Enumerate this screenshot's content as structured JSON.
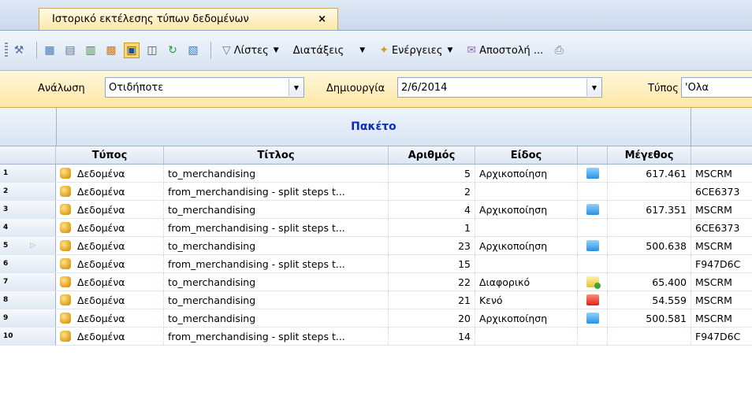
{
  "tab": {
    "title": "Ιστορικό εκτέλεσης τύπων δεδομένων",
    "close": "×"
  },
  "toolbar": {
    "lists_label": "Λίστες",
    "sorts_label": "Διατάξεις",
    "actions_label": "Ενέργειες",
    "send_label": "Αποστολή ..."
  },
  "filters": {
    "analysis_label": "Ανάλωση",
    "analysis_value": "Οτιδήποτε",
    "created_label": "Δημιουργία",
    "created_value": "2/6/2014",
    "type_label": "Τύπος",
    "type_value": "'Ολα"
  },
  "grid": {
    "group_header": "Πακέτο",
    "columns": {
      "type": "Τύπος",
      "title": "Τίτλος",
      "number": "Αριθμός",
      "kind": "Είδος",
      "size": "Μέγεθος"
    },
    "rows": [
      {
        "n": "1",
        "type": "Δεδομένα",
        "title": "to_merchandising",
        "number": "5",
        "kind": "Αρχικοποίηση",
        "kind_icon": "blue",
        "size": "617.461",
        "extra": "MSCRM"
      },
      {
        "n": "2",
        "type": "Δεδομένα",
        "title": "from_merchandising - split steps t...",
        "number": "2",
        "kind": "",
        "kind_icon": "",
        "size": "",
        "extra": "6CE6373"
      },
      {
        "n": "3",
        "type": "Δεδομένα",
        "title": "to_merchandising",
        "number": "4",
        "kind": "Αρχικοποίηση",
        "kind_icon": "blue",
        "size": "617.351",
        "extra": "MSCRM"
      },
      {
        "n": "4",
        "type": "Δεδομένα",
        "title": "from_merchandising - split steps t...",
        "number": "1",
        "kind": "",
        "kind_icon": "",
        "size": "",
        "extra": "6CE6373"
      },
      {
        "n": "5",
        "type": "Δεδομένα",
        "title": "to_merchandising",
        "number": "23",
        "kind": "Αρχικοποίηση",
        "kind_icon": "blue",
        "size": "500.638",
        "extra": "MSCRM"
      },
      {
        "n": "6",
        "type": "Δεδομένα",
        "title": "from_merchandising - split steps t...",
        "number": "15",
        "kind": "",
        "kind_icon": "",
        "size": "",
        "extra": "F947D6C"
      },
      {
        "n": "7",
        "type": "Δεδομένα",
        "title": "to_merchandising",
        "number": "22",
        "kind": "Διαφορικό",
        "kind_icon": "yellow",
        "size": "65.400",
        "extra": "MSCRM"
      },
      {
        "n": "8",
        "type": "Δεδομένα",
        "title": "to_merchandising",
        "number": "21",
        "kind": "Κενό",
        "kind_icon": "red",
        "size": "54.559",
        "extra": "MSCRM"
      },
      {
        "n": "9",
        "type": "Δεδομένα",
        "title": "to_merchandising",
        "number": "20",
        "kind": "Αρχικοποίηση",
        "kind_icon": "blue",
        "size": "500.581",
        "extra": "MSCRM"
      },
      {
        "n": "10",
        "type": "Δεδομένα",
        "title": "from_merchandising - split steps t...",
        "number": "14",
        "kind": "",
        "kind_icon": "",
        "size": "",
        "extra": "F947D6C"
      }
    ]
  }
}
